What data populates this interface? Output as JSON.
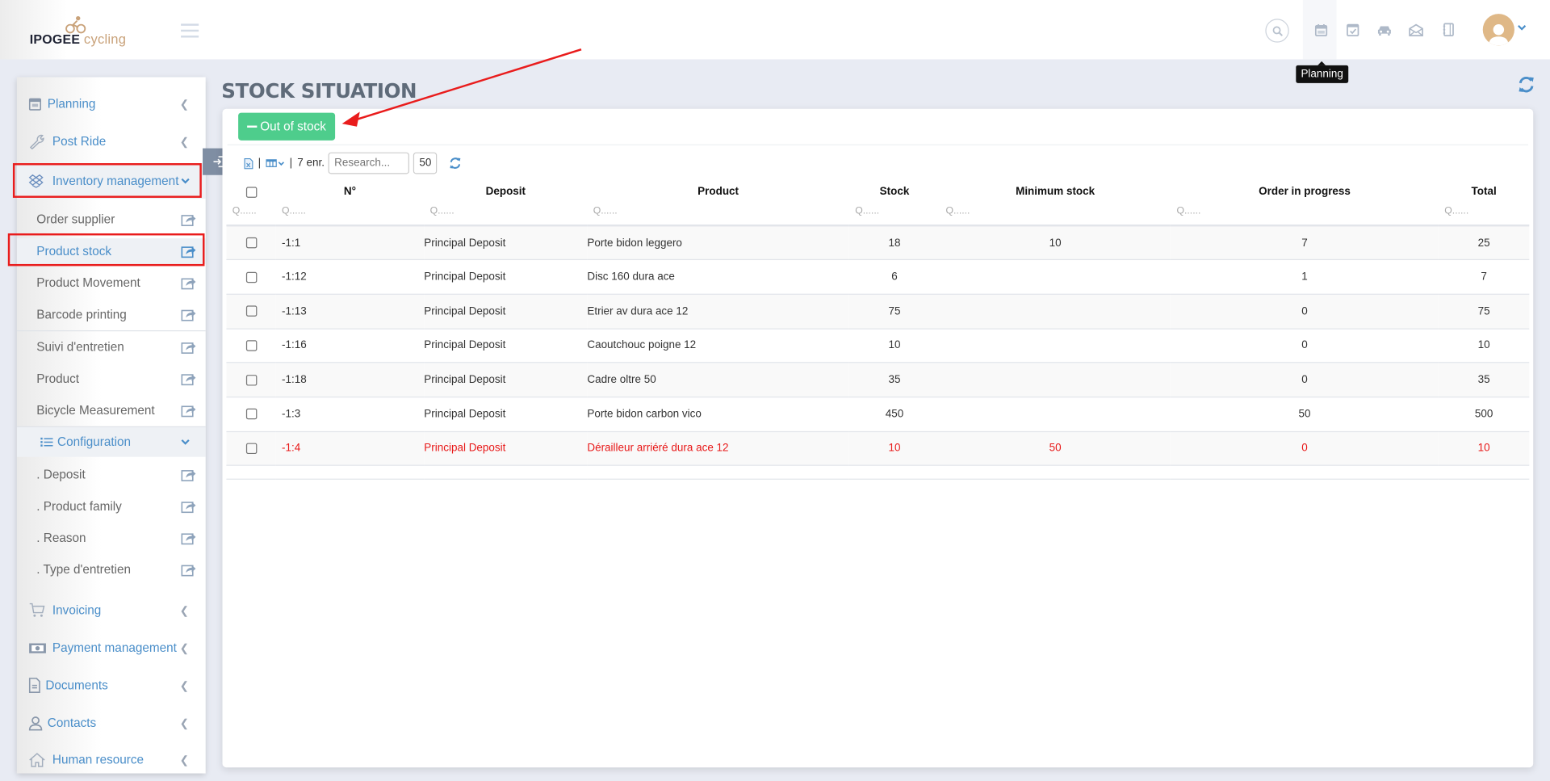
{
  "app": {
    "brand_main": "IPOGEE",
    "brand_accent": "cycling"
  },
  "header": {
    "icons": [
      "search-icon",
      "calendar-icon",
      "calendar-check-icon",
      "car-icon",
      "envelope-open-icon",
      "notebook-icon"
    ],
    "tooltip": "Planning"
  },
  "sidebar": {
    "main_items": [
      {
        "label": "Planning",
        "icon": "calendar-icon"
      },
      {
        "label": "Post Ride",
        "icon": "wrench-icon"
      },
      {
        "label": "Inventory management",
        "icon": "dropbox-icon"
      },
      {
        "label": "Invoicing",
        "icon": "cart-icon"
      },
      {
        "label": "Payment management",
        "icon": "money-icon"
      },
      {
        "label": "Documents",
        "icon": "document-icon"
      },
      {
        "label": "Contacts",
        "icon": "user-icon"
      },
      {
        "label": "Human resource",
        "icon": "home-icon"
      }
    ],
    "sub_items": [
      {
        "label": "Order supplier"
      },
      {
        "label": "Product stock"
      },
      {
        "label": "Product Movement"
      },
      {
        "label": "Barcode printing"
      },
      {
        "label": "Suivi d'entretien"
      },
      {
        "label": "Product"
      },
      {
        "label": "Bicycle Measurement"
      }
    ],
    "configuration": {
      "label": "Configuration"
    },
    "config_items": [
      {
        "label": ". Deposit"
      },
      {
        "label": ". Product family"
      },
      {
        "label": ". Reason"
      },
      {
        "label": ". Type d'entretien"
      }
    ]
  },
  "page": {
    "title": "STOCK SITUATION",
    "out_of_stock_label": "Out of stock",
    "record_count": "7 enr.",
    "search_placeholder": "Research...",
    "page_size": "50"
  },
  "table": {
    "columns": [
      "N°",
      "Deposit",
      "Product",
      "Stock",
      "Minimum stock",
      "Order in progress",
      "Total"
    ],
    "filter_placeholder": "Q......",
    "rows": [
      {
        "no": "-1:1",
        "deposit": "Principal Deposit",
        "product": "Porte bidon leggero",
        "stock": "18",
        "min_stock": "10",
        "order": "7",
        "total": "25",
        "alert": false
      },
      {
        "no": "-1:12",
        "deposit": "Principal Deposit",
        "product": "Disc 160 dura ace",
        "stock": "6",
        "min_stock": "",
        "order": "1",
        "total": "7",
        "alert": false
      },
      {
        "no": "-1:13",
        "deposit": "Principal Deposit",
        "product": "Etrier av dura ace 12",
        "stock": "75",
        "min_stock": "",
        "order": "0",
        "total": "75",
        "alert": false
      },
      {
        "no": "-1:16",
        "deposit": "Principal Deposit",
        "product": "Caoutchouc poigne 12",
        "stock": "10",
        "min_stock": "",
        "order": "0",
        "total": "10",
        "alert": false
      },
      {
        "no": "-1:18",
        "deposit": "Principal Deposit",
        "product": "Cadre oltre 50",
        "stock": "35",
        "min_stock": "",
        "order": "0",
        "total": "35",
        "alert": false
      },
      {
        "no": "-1:3",
        "deposit": "Principal Deposit",
        "product": "Porte bidon carbon vico",
        "stock": "450",
        "min_stock": "",
        "order": "50",
        "total": "500",
        "alert": false
      },
      {
        "no": "-1:4",
        "deposit": "Principal Deposit",
        "product": "Dérailleur arriéré dura ace 12",
        "stock": "10",
        "min_stock": "50",
        "order": "0",
        "total": "10",
        "alert": true
      }
    ]
  },
  "colors": {
    "accent": "#4a8ec9",
    "success": "#4ecd8c",
    "alert": "#e81818",
    "brand": "#c9a27a",
    "annotation": "#e91c1c"
  }
}
